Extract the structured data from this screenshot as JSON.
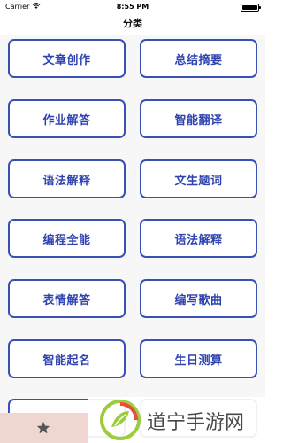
{
  "status_bar": {
    "carrier": "Carrier",
    "time": "8:55 PM",
    "wifi_icon": "wifi-icon",
    "battery_icon": "battery-icon"
  },
  "nav": {
    "title": "分类"
  },
  "categories": [
    "文章创作",
    "总结摘要",
    "作业解答",
    "智能翻译",
    "语法解释",
    "文生题词",
    "编程全能",
    "语法解释",
    "表情解答",
    "编写歌曲",
    "智能起名",
    "生日测算",
    "",
    ""
  ],
  "tab_bar": {
    "icon": "star-icon"
  },
  "watermark": {
    "text": "道宁手游网",
    "logo": "watermark-logo-icon"
  },
  "colors": {
    "accent": "#2f43b0",
    "border": "#3a4fb3",
    "tab_bg": "#f0d6d0",
    "bg": "#f7f7f7"
  }
}
